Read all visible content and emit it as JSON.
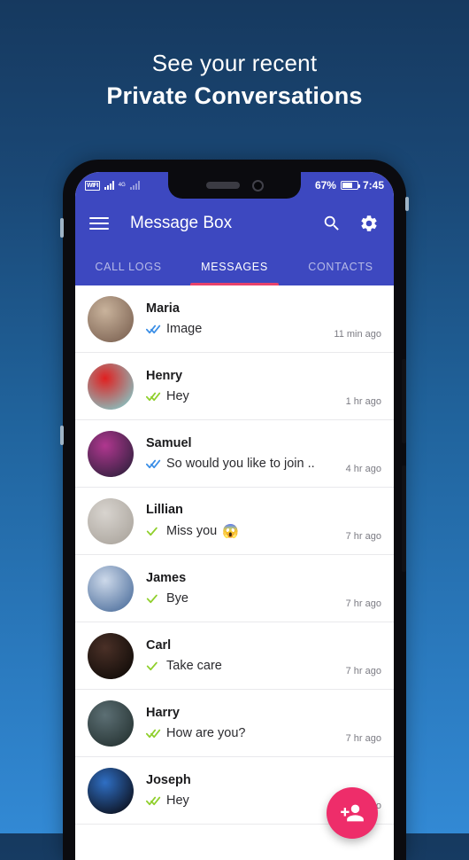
{
  "promo": {
    "line1": "See your recent",
    "line2": "Private Conversations"
  },
  "statusbar": {
    "wifi_label": "WIFI",
    "network_gen": "4G",
    "battery_percent": "67%",
    "time": "7:45"
  },
  "appbar": {
    "title": "Message Box",
    "menu_icon": "hamburger-menu-icon",
    "search_icon": "search-icon",
    "settings_icon": "gear-icon"
  },
  "tabs": [
    {
      "label": "CALL LOGS",
      "active": false
    },
    {
      "label": "MESSAGES",
      "active": true
    },
    {
      "label": "CONTACTS",
      "active": false
    }
  ],
  "messages": [
    {
      "name": "Maria",
      "preview": "Image",
      "emoji": "",
      "time": "11 min ago",
      "tick": "double-blue",
      "avatar_a": "#c9b39c",
      "avatar_b": "#7a6050"
    },
    {
      "name": "Henry",
      "preview": "Hey",
      "emoji": "",
      "time": "1 hr ago",
      "tick": "double-green",
      "avatar_a": "#e02020",
      "avatar_b": "#7fd0cf"
    },
    {
      "name": "Samuel",
      "preview": "So would you like to join ..",
      "emoji": "",
      "time": "4 hr ago",
      "tick": "double-blue",
      "avatar_a": "#b0378f",
      "avatar_b": "#2b1f3a"
    },
    {
      "name": "Lillian",
      "preview": "Miss you",
      "emoji": "😱",
      "time": "7 hr ago",
      "tick": "single-green",
      "avatar_a": "#d8d4cf",
      "avatar_b": "#a9a39b"
    },
    {
      "name": "James",
      "preview": "Bye",
      "emoji": "",
      "time": "7 hr ago",
      "tick": "single-green",
      "avatar_a": "#cdd9ea",
      "avatar_b": "#4a6c9a"
    },
    {
      "name": "Carl",
      "preview": "Take care",
      "emoji": "",
      "time": "7 hr ago",
      "tick": "single-green",
      "avatar_a": "#4a3027",
      "avatar_b": "#0d0906"
    },
    {
      "name": "Harry",
      "preview": "How are you?",
      "emoji": "",
      "time": "7 hr ago",
      "tick": "double-green",
      "avatar_a": "#5c6f74",
      "avatar_b": "#23302f"
    },
    {
      "name": "Joseph",
      "preview": "Hey",
      "emoji": "",
      "time": "7 hr ago",
      "tick": "double-green",
      "avatar_a": "#2f6fc4",
      "avatar_b": "#0a0a12"
    }
  ],
  "fab": {
    "icon": "add-person-icon",
    "color": "#ee2d6a"
  },
  "colors": {
    "appbar": "#3d48c0",
    "tab_indicator": "#e8426b",
    "tick_blue": "#3a8ee6",
    "tick_green": "#8fcf2b",
    "bg_top": "#16395f",
    "bg_bottom": "#3289d4"
  }
}
